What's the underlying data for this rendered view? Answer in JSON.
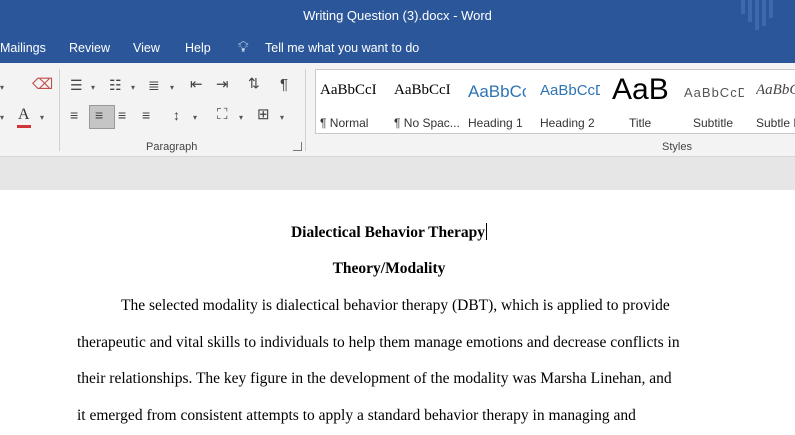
{
  "window": {
    "title": "Writing Question (3).docx  -  Word"
  },
  "menu": {
    "items": [
      "Mailings",
      "Review",
      "View",
      "Help"
    ],
    "tell_me": "Tell me what you want to do"
  },
  "ribbon": {
    "paragraph_label": "Paragraph",
    "styles_label": "Styles",
    "styles": [
      {
        "preview": "AaBbCcI",
        "name": "¶ Normal"
      },
      {
        "preview": "AaBbCcI",
        "name": "¶ No Spac..."
      },
      {
        "preview": "AaBbCc",
        "name": "Heading 1"
      },
      {
        "preview": "AaBbCcD",
        "name": "Heading 2"
      },
      {
        "preview": "AaB",
        "name": "Title"
      },
      {
        "preview": "AaBbCcD",
        "name": "Subtitle"
      },
      {
        "preview": "AaBbCcD",
        "name": "Subtle E"
      }
    ],
    "font_color": "#d13438",
    "accent": "#2b579a"
  },
  "document": {
    "title": "Dialectical Behavior Therapy",
    "subtitle": "Theory/Modality",
    "body_lines": [
      "The selected modality is dialectical behavior therapy (DBT), which is applied to provide",
      "therapeutic and vital skills to individuals to help them manage emotions and decrease conflicts in",
      "their relationships. The key figure in the development of the modality was Marsha Linehan, and",
      "it emerged from consistent attempts to apply a standard behavior therapy in managing and"
    ]
  }
}
